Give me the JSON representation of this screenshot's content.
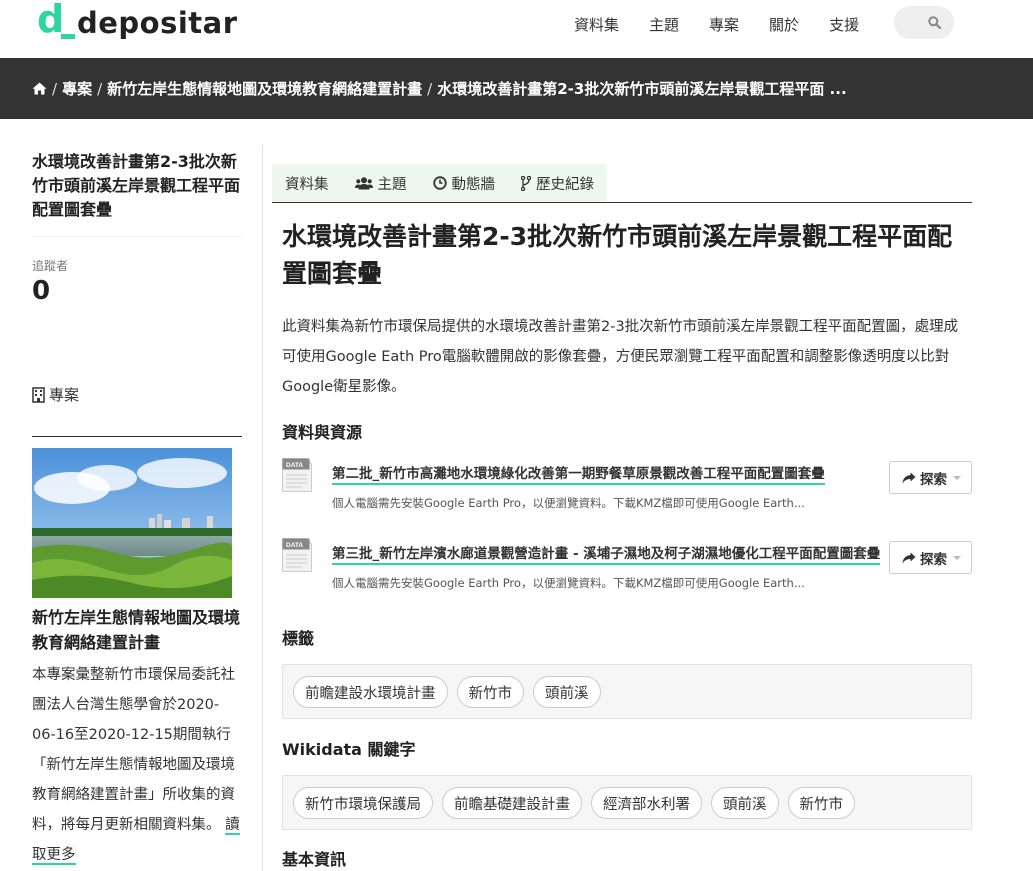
{
  "header": {
    "logo_text": "depositar",
    "nav": [
      "資料集",
      "主題",
      "專案",
      "關於",
      "支援"
    ]
  },
  "breadcrumb": {
    "items": [
      "專案",
      "新竹左岸生態情報地圖及環境教育網絡建置計畫",
      "水環境改善計畫第2-3批次新竹市頭前溪左岸景觀工程平面 ..."
    ]
  },
  "sidebar": {
    "title": "水環境改善計畫第2-3批次新竹市頭前溪左岸景觀工程平面配置圖套疊",
    "followers_label": "追蹤者",
    "followers_count": "0",
    "project_label": "專案",
    "project_name": "新竹左岸生態情報地圖及環境教育網絡建置計畫",
    "project_desc": "本專案彙整新竹市環保局委託社團法人台灣生態學會於2020-06-16至2020-12-15期間執行「新竹左岸生態情報地圖及環境教育網絡建置計畫」所收集的資料，將每月更新相關資料集。",
    "read_more": "讀取更多"
  },
  "tabs": [
    "資料集",
    "主題",
    "動態牆",
    "歷史紀錄"
  ],
  "dataset": {
    "title": "水環境改善計畫第2-3批次新竹市頭前溪左岸景觀工程平面配置圖套疊",
    "description": "此資料集為新竹市環保局提供的水環境改善計畫第2-3批次新竹市頭前溪左岸景觀工程平面配置圖，處理成可使用Google Eath Pro電腦軟體開啟的影像套疊，方便民眾瀏覽工程平面配置和調整影像透明度以比對Google衛星影像。"
  },
  "resources": {
    "heading": "資料與資源",
    "icon_label": "DATA",
    "explore_label": "探索",
    "items": [
      {
        "title": "第二批_新竹市高灘地水環境綠化改善第一期野餐草原景觀改善工程平面配置圖套疊",
        "desc": "個人電腦需先安裝Google Earth Pro，以便瀏覽資料。下載KMZ檔即可使用Google Earth..."
      },
      {
        "title": "第三批_新竹左岸濱水廊道景觀營造計畫 - 溪埔子濕地及柯子湖濕地優化工程平面配置圖套疊",
        "desc": "個人電腦需先安裝Google Earth Pro，以便瀏覽資料。下載KMZ檔即可使用Google Earth..."
      }
    ]
  },
  "tags": {
    "heading": "標籤",
    "items": [
      "前瞻建設水環境計畫",
      "新竹市",
      "頭前溪"
    ]
  },
  "wikidata": {
    "heading": "Wikidata 關鍵字",
    "items": [
      "新竹市環境保護局",
      "前瞻基礎建設計畫",
      "經濟部水利署",
      "頭前溪",
      "新竹市"
    ]
  },
  "basic_info": {
    "heading": "基本資訊"
  },
  "colors": {
    "accent": "#2fd4a0",
    "dark_bar": "#333333",
    "tab_bg": "#eef7f2"
  }
}
